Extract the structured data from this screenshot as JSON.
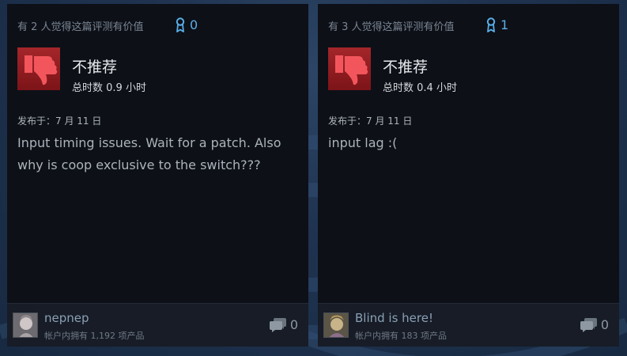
{
  "colors": {
    "award_accent": "#5aaee8",
    "thumb_red": "#a4262a",
    "card_bg": "#0d1017",
    "footer_bg": "#171c26"
  },
  "reviews": [
    {
      "helpful_text": "有 2 人觉得这篇评测有价值",
      "award_icon": "award-ribbon-icon",
      "award_count": "0",
      "verdict_icon": "thumbs-down-icon",
      "verdict": "不推荐",
      "hours": "总时数 0.9 小时",
      "posted": "发布于：7 月 11 日",
      "body": "Input timing issues. Wait for a patch. Also why is coop exclusive to the switch???",
      "author": {
        "name": "nepnep",
        "owns": "帐户内拥有 1,192 项产品"
      },
      "comment_icon": "comments-icon",
      "comment_count": "0"
    },
    {
      "helpful_text": "有 3 人觉得这篇评测有价值",
      "award_icon": "award-ribbon-icon",
      "award_count": "1",
      "verdict_icon": "thumbs-down-icon",
      "verdict": "不推荐",
      "hours": "总时数 0.4 小时",
      "posted": "发布于：7 月 11 日",
      "body": "input lag :(",
      "author": {
        "name": "Blind is here!",
        "owns": "帐户内拥有 183 项产品"
      },
      "comment_icon": "comments-icon",
      "comment_count": "0"
    }
  ]
}
